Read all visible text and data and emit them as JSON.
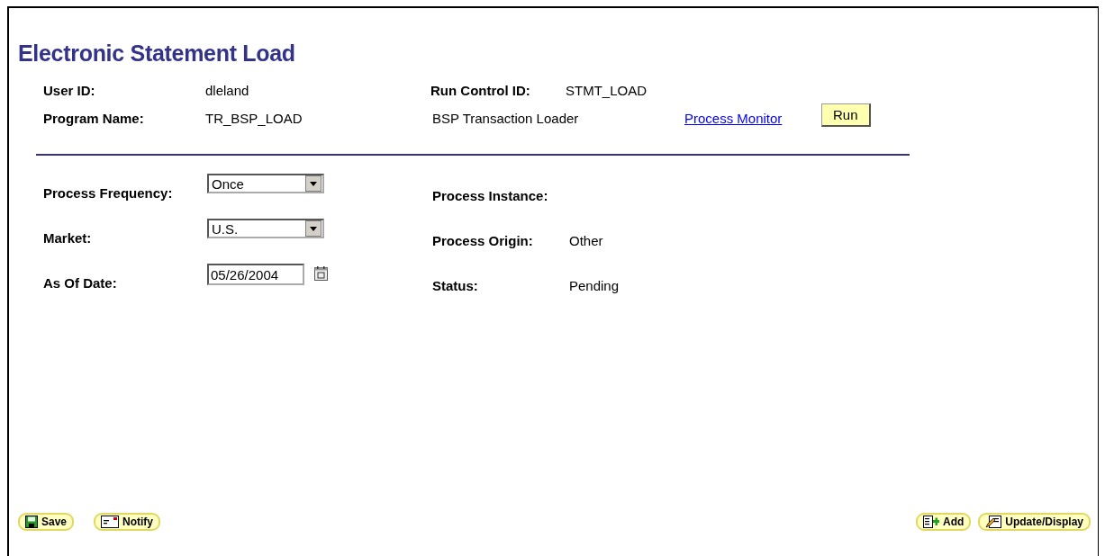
{
  "title": "Electronic Statement Load",
  "header": {
    "user_id": {
      "label": "User ID:",
      "value": "dleland"
    },
    "run_control_id": {
      "label": "Run Control ID:",
      "value": "STMT_LOAD"
    },
    "program_name": {
      "label": "Program Name:",
      "value": "TR_BSP_LOAD"
    },
    "program_description": "BSP Transaction Loader",
    "process_monitor_link": "Process Monitor",
    "run_button": "Run"
  },
  "fields": [
    {
      "label": "Process Frequency:",
      "kind": "dropdown",
      "value": "Once"
    },
    {
      "label": "Market:",
      "kind": "dropdown",
      "value": "U.S."
    },
    {
      "label": "As Of Date:",
      "kind": "date",
      "value": "05/26/2004"
    }
  ],
  "process_info": [
    {
      "label": "Process Instance:"
    },
    {
      "label": "Process Origin:",
      "value": "Other"
    },
    {
      "label": "Status:",
      "value": "Pending"
    }
  ],
  "footer_left": [
    {
      "kind": "save",
      "label": "Save"
    },
    {
      "kind": "notify",
      "label": "Notify"
    }
  ],
  "footer_right": [
    {
      "kind": "add",
      "label": "Add"
    },
    {
      "kind": "update",
      "label": "Update/Display"
    }
  ]
}
